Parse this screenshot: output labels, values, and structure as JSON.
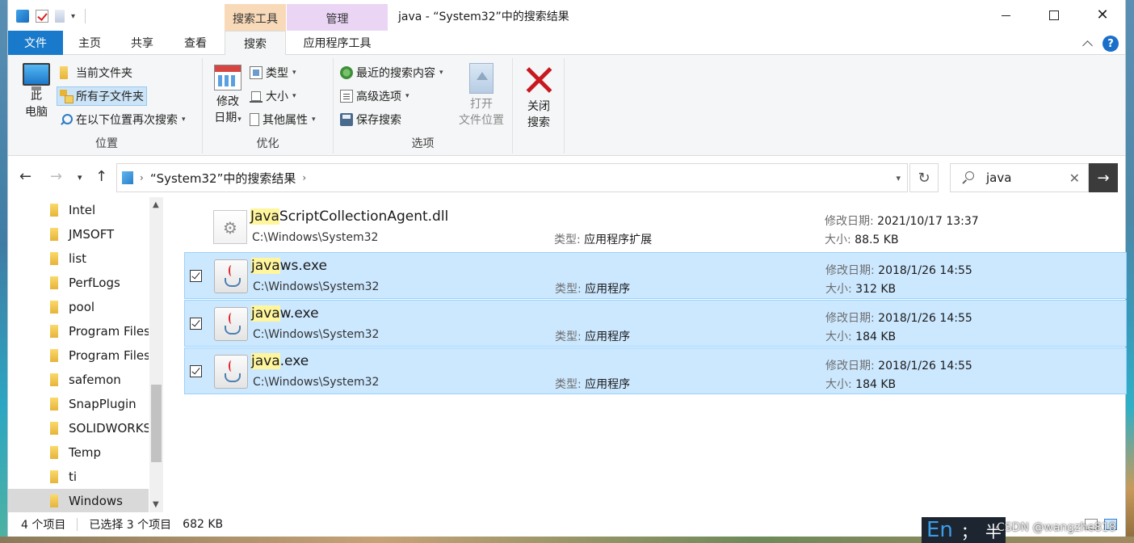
{
  "window": {
    "title": "java - “System32”中的搜索结果",
    "context_tab_search_tools": "搜索工具",
    "context_tab_manage": "管理",
    "close_glyph": "✕"
  },
  "tabs": {
    "file": "文件",
    "home": "主页",
    "share": "共享",
    "view": "查看",
    "search": "搜索",
    "app_tools": "应用程序工具",
    "help": "?"
  },
  "ribbon": {
    "location": {
      "label": "位置",
      "this_pc_line1": "此",
      "this_pc_line2": "电脑",
      "current_folder": "当前文件夹",
      "all_subfolders": "所有子文件夹",
      "search_again_in": "在以下位置再次搜索"
    },
    "refine": {
      "label": "优化",
      "date_modified_line1": "修改",
      "date_modified_line2": "日期",
      "type": "类型",
      "size": "大小",
      "other_properties": "其他属性"
    },
    "options": {
      "label": "选项",
      "recent_searches": "最近的搜索内容",
      "advanced_options": "高级选项",
      "save_search": "保存搜索",
      "open_location_line1": "打开",
      "open_location_line2": "文件位置"
    },
    "close": {
      "close_line1": "关闭",
      "close_line2": "搜索"
    },
    "dropdown_glyph": "▾"
  },
  "address": {
    "path": "“System32”中的搜索结果",
    "search_query": "java"
  },
  "nav_tree": [
    {
      "label": "Intel"
    },
    {
      "label": "JMSOFT"
    },
    {
      "label": "list"
    },
    {
      "label": "PerfLogs"
    },
    {
      "label": "pool"
    },
    {
      "label": "Program Files"
    },
    {
      "label": "Program Files"
    },
    {
      "label": "safemon"
    },
    {
      "label": "SnapPlugin"
    },
    {
      "label": "SOLIDWORKS"
    },
    {
      "label": "Temp"
    },
    {
      "label": "ti"
    },
    {
      "label": "Windows"
    }
  ],
  "files": [
    {
      "name_highlight": "Java",
      "name_rest": "ScriptCollectionAgent.dll",
      "path": "C:\\Windows\\System32",
      "type_label": "类型:",
      "type": "应用程序扩展",
      "date_label": "修改日期:",
      "date": "2021/10/17 13:37",
      "size_label": "大小:",
      "size": "88.5 KB"
    },
    {
      "name_highlight": "java",
      "name_rest": "ws.exe",
      "path": "C:\\Windows\\System32",
      "type_label": "类型:",
      "type": "应用程序",
      "date_label": "修改日期:",
      "date": "2018/1/26 14:55",
      "size_label": "大小:",
      "size": "312 KB"
    },
    {
      "name_highlight": "java",
      "name_rest": "w.exe",
      "path": "C:\\Windows\\System32",
      "type_label": "类型:",
      "type": "应用程序",
      "date_label": "修改日期:",
      "date": "2018/1/26 14:55",
      "size_label": "大小:",
      "size": "184 KB"
    },
    {
      "name_highlight": "java",
      "name_rest": ".exe",
      "path": "C:\\Windows\\System32",
      "type_label": "类型:",
      "type": "应用程序",
      "date_label": "修改日期:",
      "date": "2018/1/26 14:55",
      "size_label": "大小:",
      "size": "184 KB"
    }
  ],
  "status": {
    "item_count": "4 个项目",
    "selected": "已选择 3 个项目",
    "selected_size": "682 KB"
  },
  "ime": {
    "lang": "En",
    "punct": "；",
    "width": "半"
  },
  "watermark": "CSDN @wangzhe818"
}
